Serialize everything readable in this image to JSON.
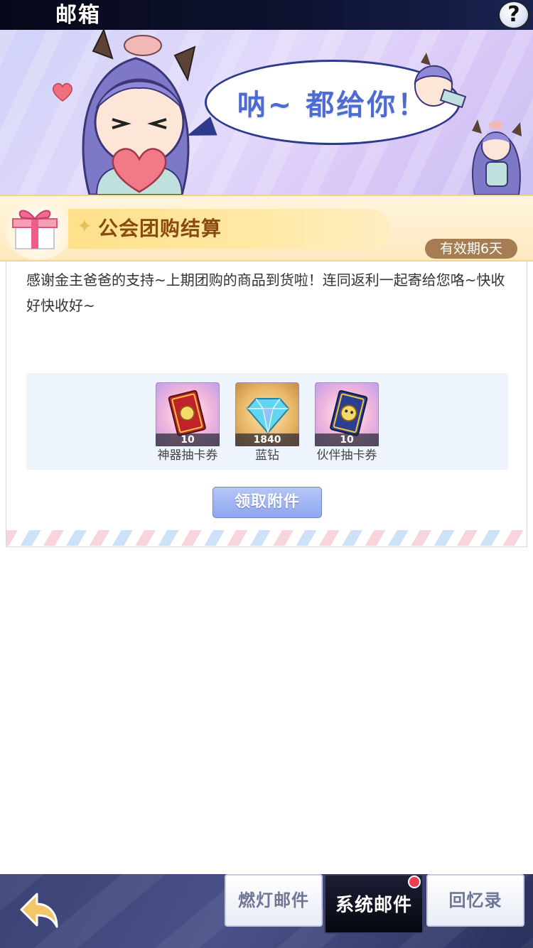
{
  "header": {
    "title": "邮箱",
    "help_label": "?"
  },
  "banner": {
    "speech": "呐~ 都给你！"
  },
  "mail": {
    "subject": "公会团购结算",
    "expiry": "有效期6天",
    "body": "感谢金主爸爸的支持~上期团购的商品到货啦！连同返利一起寄给您咯~快收好快收好~",
    "attachments": [
      {
        "name": "神器抽卡券",
        "count": "10",
        "icon": "artifact-card-ticket-icon"
      },
      {
        "name": "蓝钻",
        "count": "1840",
        "icon": "blue-diamond-icon"
      },
      {
        "name": "伙伴抽卡券",
        "count": "10",
        "icon": "partner-card-ticket-icon"
      }
    ],
    "claim_label": "领取附件"
  },
  "tabs": [
    {
      "label": "燃灯邮件",
      "active": false
    },
    {
      "label": "系统邮件",
      "active": true,
      "badge": true
    },
    {
      "label": "回忆录",
      "active": false
    }
  ],
  "colors": {
    "accent_blue": "#8ea6ef",
    "badge_red": "#ee3d4f",
    "subject_brown": "#8a4a0e"
  }
}
